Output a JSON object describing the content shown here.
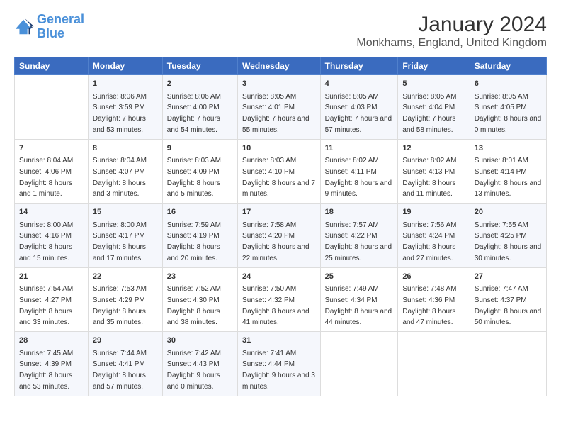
{
  "header": {
    "logo_line1": "General",
    "logo_line2": "Blue",
    "title": "January 2024",
    "subtitle": "Monkhams, England, United Kingdom"
  },
  "columns": [
    "Sunday",
    "Monday",
    "Tuesday",
    "Wednesday",
    "Thursday",
    "Friday",
    "Saturday"
  ],
  "weeks": [
    [
      {
        "day": "",
        "sunrise": "",
        "sunset": "",
        "daylight": ""
      },
      {
        "day": "1",
        "sunrise": "Sunrise: 8:06 AM",
        "sunset": "Sunset: 3:59 PM",
        "daylight": "Daylight: 7 hours and 53 minutes."
      },
      {
        "day": "2",
        "sunrise": "Sunrise: 8:06 AM",
        "sunset": "Sunset: 4:00 PM",
        "daylight": "Daylight: 7 hours and 54 minutes."
      },
      {
        "day": "3",
        "sunrise": "Sunrise: 8:05 AM",
        "sunset": "Sunset: 4:01 PM",
        "daylight": "Daylight: 7 hours and 55 minutes."
      },
      {
        "day": "4",
        "sunrise": "Sunrise: 8:05 AM",
        "sunset": "Sunset: 4:03 PM",
        "daylight": "Daylight: 7 hours and 57 minutes."
      },
      {
        "day": "5",
        "sunrise": "Sunrise: 8:05 AM",
        "sunset": "Sunset: 4:04 PM",
        "daylight": "Daylight: 7 hours and 58 minutes."
      },
      {
        "day": "6",
        "sunrise": "Sunrise: 8:05 AM",
        "sunset": "Sunset: 4:05 PM",
        "daylight": "Daylight: 8 hours and 0 minutes."
      }
    ],
    [
      {
        "day": "7",
        "sunrise": "Sunrise: 8:04 AM",
        "sunset": "Sunset: 4:06 PM",
        "daylight": "Daylight: 8 hours and 1 minute."
      },
      {
        "day": "8",
        "sunrise": "Sunrise: 8:04 AM",
        "sunset": "Sunset: 4:07 PM",
        "daylight": "Daylight: 8 hours and 3 minutes."
      },
      {
        "day": "9",
        "sunrise": "Sunrise: 8:03 AM",
        "sunset": "Sunset: 4:09 PM",
        "daylight": "Daylight: 8 hours and 5 minutes."
      },
      {
        "day": "10",
        "sunrise": "Sunrise: 8:03 AM",
        "sunset": "Sunset: 4:10 PM",
        "daylight": "Daylight: 8 hours and 7 minutes."
      },
      {
        "day": "11",
        "sunrise": "Sunrise: 8:02 AM",
        "sunset": "Sunset: 4:11 PM",
        "daylight": "Daylight: 8 hours and 9 minutes."
      },
      {
        "day": "12",
        "sunrise": "Sunrise: 8:02 AM",
        "sunset": "Sunset: 4:13 PM",
        "daylight": "Daylight: 8 hours and 11 minutes."
      },
      {
        "day": "13",
        "sunrise": "Sunrise: 8:01 AM",
        "sunset": "Sunset: 4:14 PM",
        "daylight": "Daylight: 8 hours and 13 minutes."
      }
    ],
    [
      {
        "day": "14",
        "sunrise": "Sunrise: 8:00 AM",
        "sunset": "Sunset: 4:16 PM",
        "daylight": "Daylight: 8 hours and 15 minutes."
      },
      {
        "day": "15",
        "sunrise": "Sunrise: 8:00 AM",
        "sunset": "Sunset: 4:17 PM",
        "daylight": "Daylight: 8 hours and 17 minutes."
      },
      {
        "day": "16",
        "sunrise": "Sunrise: 7:59 AM",
        "sunset": "Sunset: 4:19 PM",
        "daylight": "Daylight: 8 hours and 20 minutes."
      },
      {
        "day": "17",
        "sunrise": "Sunrise: 7:58 AM",
        "sunset": "Sunset: 4:20 PM",
        "daylight": "Daylight: 8 hours and 22 minutes."
      },
      {
        "day": "18",
        "sunrise": "Sunrise: 7:57 AM",
        "sunset": "Sunset: 4:22 PM",
        "daylight": "Daylight: 8 hours and 25 minutes."
      },
      {
        "day": "19",
        "sunrise": "Sunrise: 7:56 AM",
        "sunset": "Sunset: 4:24 PM",
        "daylight": "Daylight: 8 hours and 27 minutes."
      },
      {
        "day": "20",
        "sunrise": "Sunrise: 7:55 AM",
        "sunset": "Sunset: 4:25 PM",
        "daylight": "Daylight: 8 hours and 30 minutes."
      }
    ],
    [
      {
        "day": "21",
        "sunrise": "Sunrise: 7:54 AM",
        "sunset": "Sunset: 4:27 PM",
        "daylight": "Daylight: 8 hours and 33 minutes."
      },
      {
        "day": "22",
        "sunrise": "Sunrise: 7:53 AM",
        "sunset": "Sunset: 4:29 PM",
        "daylight": "Daylight: 8 hours and 35 minutes."
      },
      {
        "day": "23",
        "sunrise": "Sunrise: 7:52 AM",
        "sunset": "Sunset: 4:30 PM",
        "daylight": "Daylight: 8 hours and 38 minutes."
      },
      {
        "day": "24",
        "sunrise": "Sunrise: 7:50 AM",
        "sunset": "Sunset: 4:32 PM",
        "daylight": "Daylight: 8 hours and 41 minutes."
      },
      {
        "day": "25",
        "sunrise": "Sunrise: 7:49 AM",
        "sunset": "Sunset: 4:34 PM",
        "daylight": "Daylight: 8 hours and 44 minutes."
      },
      {
        "day": "26",
        "sunrise": "Sunrise: 7:48 AM",
        "sunset": "Sunset: 4:36 PM",
        "daylight": "Daylight: 8 hours and 47 minutes."
      },
      {
        "day": "27",
        "sunrise": "Sunrise: 7:47 AM",
        "sunset": "Sunset: 4:37 PM",
        "daylight": "Daylight: 8 hours and 50 minutes."
      }
    ],
    [
      {
        "day": "28",
        "sunrise": "Sunrise: 7:45 AM",
        "sunset": "Sunset: 4:39 PM",
        "daylight": "Daylight: 8 hours and 53 minutes."
      },
      {
        "day": "29",
        "sunrise": "Sunrise: 7:44 AM",
        "sunset": "Sunset: 4:41 PM",
        "daylight": "Daylight: 8 hours and 57 minutes."
      },
      {
        "day": "30",
        "sunrise": "Sunrise: 7:42 AM",
        "sunset": "Sunset: 4:43 PM",
        "daylight": "Daylight: 9 hours and 0 minutes."
      },
      {
        "day": "31",
        "sunrise": "Sunrise: 7:41 AM",
        "sunset": "Sunset: 4:44 PM",
        "daylight": "Daylight: 9 hours and 3 minutes."
      },
      {
        "day": "",
        "sunrise": "",
        "sunset": "",
        "daylight": ""
      },
      {
        "day": "",
        "sunrise": "",
        "sunset": "",
        "daylight": ""
      },
      {
        "day": "",
        "sunrise": "",
        "sunset": "",
        "daylight": ""
      }
    ]
  ]
}
